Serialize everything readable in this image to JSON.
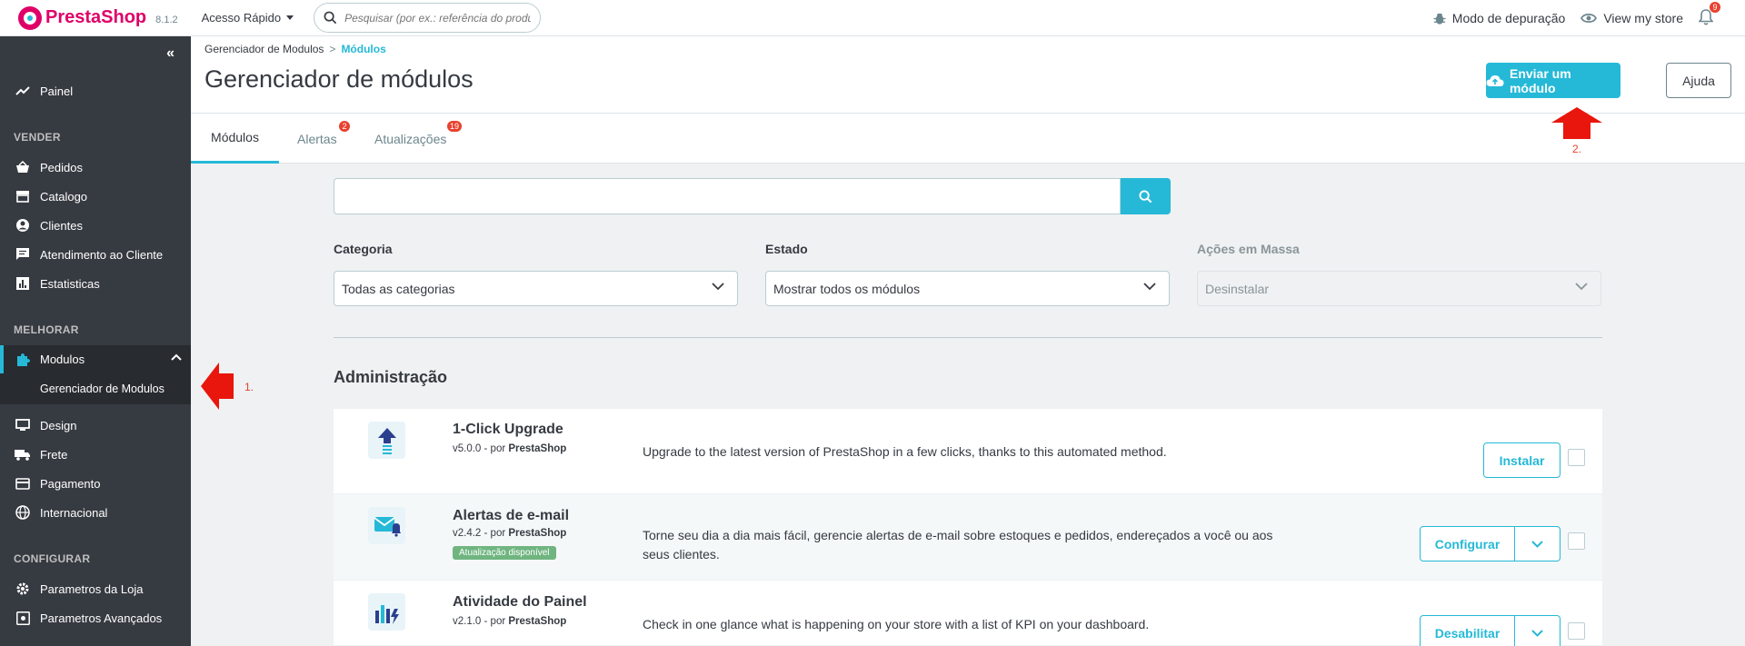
{
  "header": {
    "logo_prefix": "Presta",
    "logo_suffix": "Shop",
    "version": "8.1.2",
    "quick_access": "Acesso Rápido",
    "search_placeholder": "Pesquisar (por ex.: referência do produto",
    "debug_mode": "Modo de depuração",
    "view_store": "View my store",
    "notifications_count": "9"
  },
  "sidebar": {
    "dashboard": "Painel",
    "section_sell": "VENDER",
    "orders": "Pedidos",
    "catalog": "Catalogo",
    "customers": "Clientes",
    "customer_service": "Atendimento ao Cliente",
    "stats": "Estatisticas",
    "section_improve": "MELHORAR",
    "modules": "Modulos",
    "module_manager": "Gerenciador de Modulos",
    "design": "Design",
    "shipping": "Frete",
    "payment": "Pagamento",
    "international": "Internacional",
    "section_configure": "CONFIGURAR",
    "shop_params": "Parametros da Loja",
    "advanced_params": "Parametros Avançados"
  },
  "page": {
    "breadcrumb_parent": "Gerenciador de Modulos",
    "breadcrumb_sep": ">",
    "breadcrumb_current": "Módulos",
    "title": "Gerenciador de módulos",
    "upload_button": "Enviar um módulo",
    "help_button": "Ajuda"
  },
  "tabs": [
    {
      "label": "Módulos",
      "badge": ""
    },
    {
      "label": "Alertas",
      "badge": "2"
    },
    {
      "label": "Atualizações",
      "badge": "19"
    }
  ],
  "filters": {
    "category_label": "Categoria",
    "category_value": "Todas as categorias",
    "state_label": "Estado",
    "state_value": "Mostrar todos os módulos",
    "bulk_label": "Ações em Massa",
    "bulk_value": "Desinstalar"
  },
  "section_title": "Administração",
  "modules": [
    {
      "name": "1-Click Upgrade",
      "version": "v5.0.0 - por",
      "author": "PrestaShop",
      "badge": "",
      "description": "Upgrade to the latest version of PrestaShop in a few clicks, thanks to this automated method.",
      "action": "Instalar"
    },
    {
      "name": "Alertas de e-mail",
      "version": "v2.4.2 - por",
      "author": "PrestaShop",
      "badge": "Atualização disponível",
      "description": "Torne seu dia a dia mais fácil, gerencie alertas de e-mail sobre estoques e pedidos, endereçados a você ou aos seus clientes.",
      "action": "Configurar"
    },
    {
      "name": "Atividade do Painel",
      "version": "v2.1.0 - por",
      "author": "PrestaShop",
      "badge": "",
      "description": "Check in one glance what is happening on your store with a list of KPI on your dashboard.",
      "action": "Desabilitar"
    }
  ],
  "annotations": {
    "step1": "1.",
    "step2": "2."
  },
  "colors": {
    "accent": "#25b9d7",
    "sidebar": "#363a41",
    "brand": "#df0067",
    "annotation": "#e8412f"
  }
}
